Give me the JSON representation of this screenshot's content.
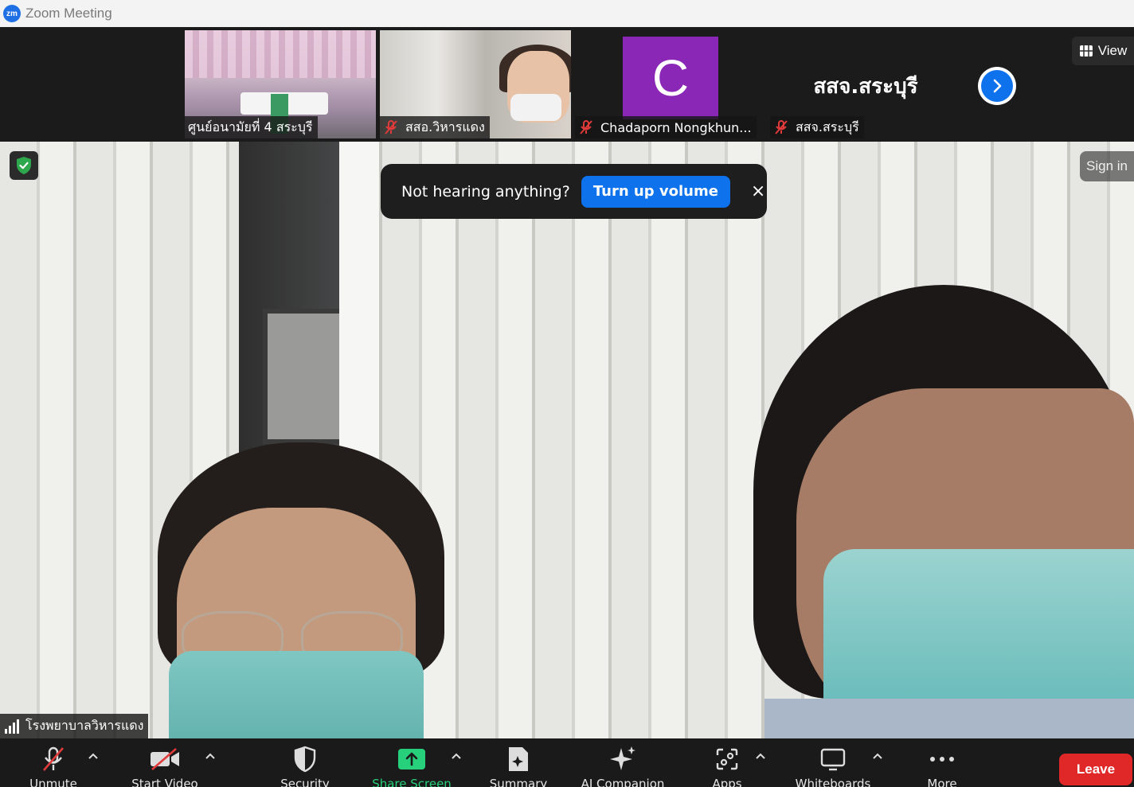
{
  "window": {
    "app_icon": "zm",
    "title": "Zoom Meeting"
  },
  "strip": {
    "tiles": [
      {
        "name": "ศูนย์อนามัยที่ 4 สระบุรี",
        "muted": false
      },
      {
        "name": "สสอ.วิหารแดง",
        "muted": true
      },
      {
        "name": "Chadaporn Nongkhun...",
        "muted": true,
        "avatar_letter": "C",
        "avatar_color": "#8a27b7"
      },
      {
        "name": "สสจ.สระบุรี",
        "muted": true,
        "display_name": "สสจ.สระบุรี"
      }
    ],
    "view_label": "View"
  },
  "main": {
    "sign_in_label": "Sign in",
    "notification": {
      "text": "Not hearing anything?",
      "action_label": "Turn up volume",
      "close_glyph": "×"
    },
    "speaker_name": "โรงพยาบาลวิหารแดง"
  },
  "toolbar": {
    "unmute": "Unmute",
    "start_video": "Start Video",
    "security": "Security",
    "share_screen": "Share Screen",
    "summary": "Summary",
    "ai_companion": "AI Companion",
    "apps": "Apps",
    "whiteboards": "Whiteboards",
    "more": "More",
    "leave": "Leave"
  },
  "colors": {
    "accent_blue": "#0e72ed",
    "leave_red": "#e02828",
    "share_green": "#27d07a",
    "shield_green": "#2ea84d"
  }
}
